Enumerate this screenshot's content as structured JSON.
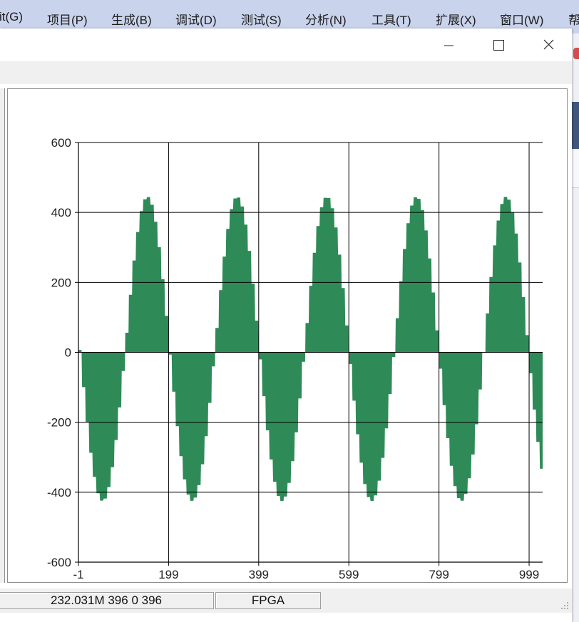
{
  "ide_menu": [
    "it(G)",
    "项目(P)",
    "生成(B)",
    "调试(D)",
    "测试(S)",
    "分析(N)",
    "工具(T)",
    "扩展(X)",
    "窗口(W)",
    "帮"
  ],
  "status": {
    "info": "232.031M 396 0 396",
    "mode": "FPGA"
  },
  "colors": {
    "series": "#2e8b57",
    "grid": "#000000",
    "menubar": "#c9d3ec"
  },
  "icons": [
    "minimize-icon",
    "maximize-icon",
    "close-icon",
    "resize-grip-icon"
  ],
  "chart_data": {
    "type": "area",
    "title": "",
    "xlabel": "",
    "ylabel": "",
    "xlim": [
      -1,
      1029
    ],
    "ylim": [
      -600,
      600
    ],
    "x_ticks": [
      -1,
      199,
      399,
      599,
      799,
      999
    ],
    "y_ticks": [
      600,
      400,
      200,
      0,
      -200,
      -400,
      -600
    ],
    "grid": true,
    "legend": "none",
    "series": [
      {
        "period": 199,
        "amplitude_positive": 445,
        "amplitude_negative": -425,
        "phase_zero_crossing_x": 99
      }
    ]
  }
}
